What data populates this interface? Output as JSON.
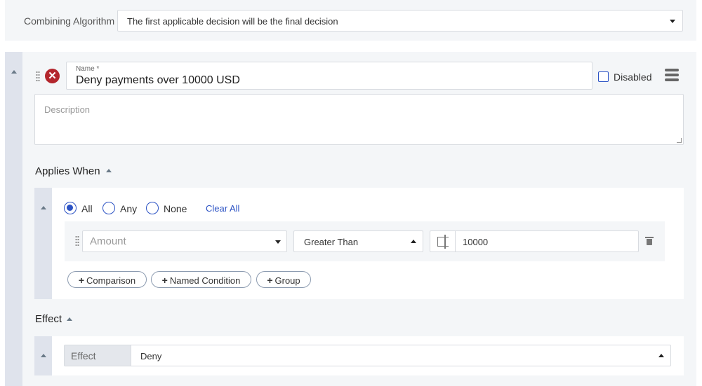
{
  "combining_algorithm": {
    "label": "Combining Algorithm",
    "value": "The first applicable decision will be the final decision"
  },
  "rule": {
    "name_label": "Name",
    "name_required_marker": "*",
    "name_value": "Deny payments over 10000 USD",
    "disabled_label": "Disabled",
    "disabled_checked": false,
    "description_placeholder": "Description",
    "description_value": ""
  },
  "applies_when": {
    "heading": "Applies When",
    "match_options": [
      {
        "label": "All",
        "selected": true
      },
      {
        "label": "Any",
        "selected": false
      },
      {
        "label": "None",
        "selected": false
      }
    ],
    "clear_all_label": "Clear All",
    "condition": {
      "attribute_placeholder": "Amount",
      "operator": "Greater Than",
      "value": "10000"
    },
    "add_buttons": {
      "comparison": "Comparison",
      "named_condition": "Named Condition",
      "group": "Group",
      "plus": "+"
    }
  },
  "effect": {
    "heading": "Effect",
    "field_label": "Effect",
    "value": "Deny"
  },
  "colors": {
    "accent": "#2b52c4",
    "danger": "#b3262d",
    "panel_bg": "#f4f6f8",
    "strip_bg": "#dfe3ec"
  }
}
